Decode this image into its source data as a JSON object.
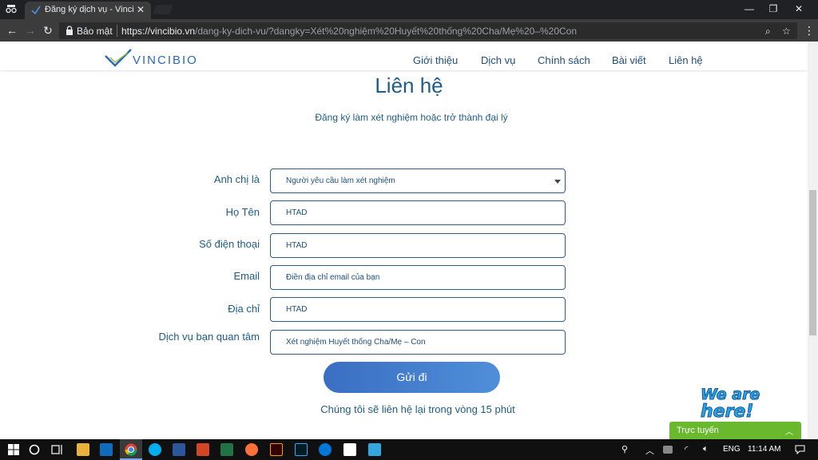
{
  "browser": {
    "tab_title": "Đăng ký dịch vụ - Vincibi",
    "secure_label": "Bảo mật",
    "url_host": "https://vincibio.vn",
    "url_path": "/dang-ky-dich-vu/?dangky=Xét%20nghiệm%20Huyết%20thống%20Cha/Mẹ%20–%20Con"
  },
  "site": {
    "logo_text": "VINCIBIO",
    "nav": [
      "Giới thiệu",
      "Dịch vụ",
      "Chính sách",
      "Bài viết",
      "Liên hệ"
    ]
  },
  "contact": {
    "heading": "Liên hệ",
    "subheading": "Đăng ký làm xét nghiệm hoặc trở thành đại lý",
    "fields": [
      {
        "label": "Anh chị là",
        "value": "Người yêu cầu làm xét nghiệm"
      },
      {
        "label": "Họ Tên",
        "value": "HTAD"
      },
      {
        "label": "Số điện thoại",
        "value": "HTAD"
      },
      {
        "label": "Email",
        "placeholder": "Điền địa chỉ email của bạn"
      },
      {
        "label": "Địa chỉ",
        "value": "HTAD"
      },
      {
        "label": "Dịch vụ bạn quan tâm",
        "value": "Xét nghiệm Huyết thống Cha/Mẹ – Con"
      }
    ],
    "submit_label": "Gửi đi",
    "note": "Chúng tôi sẽ liên hệ lại trong vòng 15 phút"
  },
  "chat": {
    "badge": "We are here!",
    "label": "Trực tuyến"
  },
  "taskbar": {
    "language": "ENG",
    "time": "11:14 AM"
  },
  "colors": {
    "brand_blue": "#1d5c85",
    "button_blue": "#3a6ec2",
    "chat_green": "#6ab82e"
  }
}
